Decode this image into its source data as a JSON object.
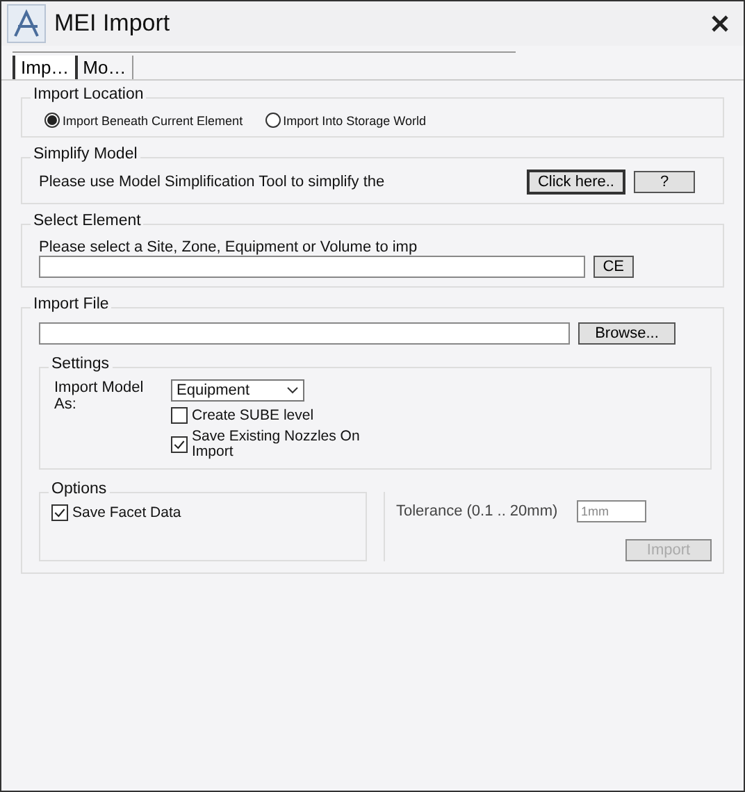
{
  "window": {
    "title": "MEI Import"
  },
  "tabs": [
    {
      "label": "Imp…",
      "selected": true
    },
    {
      "label": "Mo…",
      "selected": false
    }
  ],
  "import_location": {
    "title": "Import Location",
    "options": [
      {
        "label": "Import Beneath Current Element",
        "selected": true
      },
      {
        "label": "Import Into Storage World",
        "selected": false
      }
    ]
  },
  "simplify_model": {
    "title": "Simplify Model",
    "text": "Please use Model Simplification Tool to simplify the",
    "buttons": [
      "Click here..",
      "?"
    ]
  },
  "select_element": {
    "title": "Select Element",
    "text": "Please select a Site, Zone, Equipment or Volume to imp",
    "button": "CE"
  },
  "import_file": {
    "title": "Import File",
    "button": "Browse...",
    "settings": {
      "title": "Settings",
      "model_label": "Import Model As:",
      "model_value": "Equipment",
      "checkboxes": [
        {
          "label": "Create SUBE level",
          "checked": false
        },
        {
          "label": "Save Existing Nozzles On Import",
          "checked": true
        }
      ]
    },
    "options": {
      "title": "Options",
      "checkboxes": [
        {
          "label": "Save Facet Data",
          "checked": true
        }
      ],
      "tolerance_label": "Tolerance (0.1 .. 20mm)",
      "tolerance_value": "1mm"
    },
    "import_button": {
      "label": "Import",
      "disabled": true
    }
  }
}
